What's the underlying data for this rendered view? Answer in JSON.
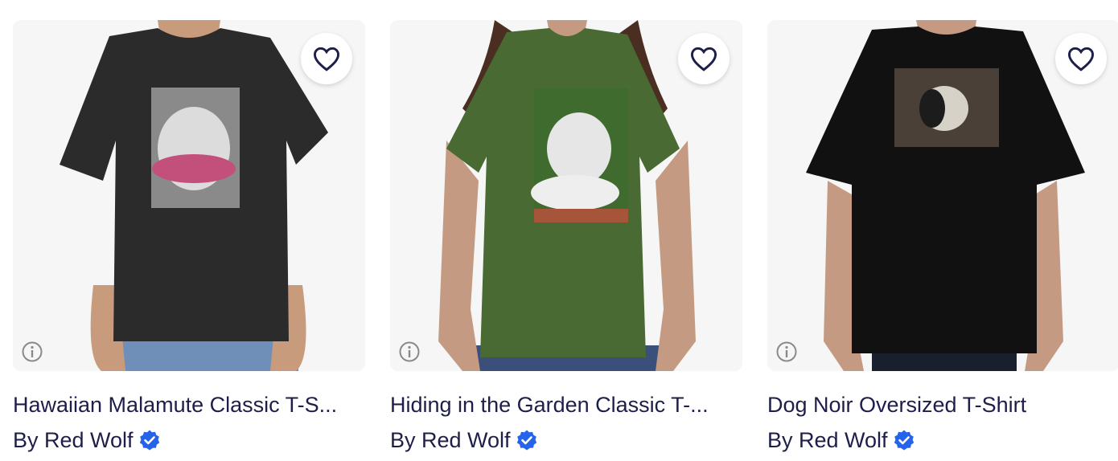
{
  "products": [
    {
      "title": "Hawaiian Malamute Classic T-S...",
      "byline": "By Red Wolf",
      "shirt_color": "#2b2b2b",
      "favorite_icon": "heart-outline-icon",
      "info_icon": "info-icon",
      "verified_icon": "verified-badge-icon"
    },
    {
      "title": "Hiding in the Garden Classic T-...",
      "byline": "By Red Wolf",
      "shirt_color": "#4a6a34",
      "favorite_icon": "heart-outline-icon",
      "info_icon": "info-icon",
      "verified_icon": "verified-badge-icon"
    },
    {
      "title": "Dog Noir Oversized T-Shirt",
      "byline": "By Red Wolf",
      "shirt_color": "#111111",
      "favorite_icon": "heart-outline-icon",
      "info_icon": "info-icon",
      "verified_icon": "verified-badge-icon"
    }
  ],
  "colors": {
    "text": "#1e1e4a",
    "verified_badge": "#2563eb",
    "card_background": "#f6f6f7"
  }
}
